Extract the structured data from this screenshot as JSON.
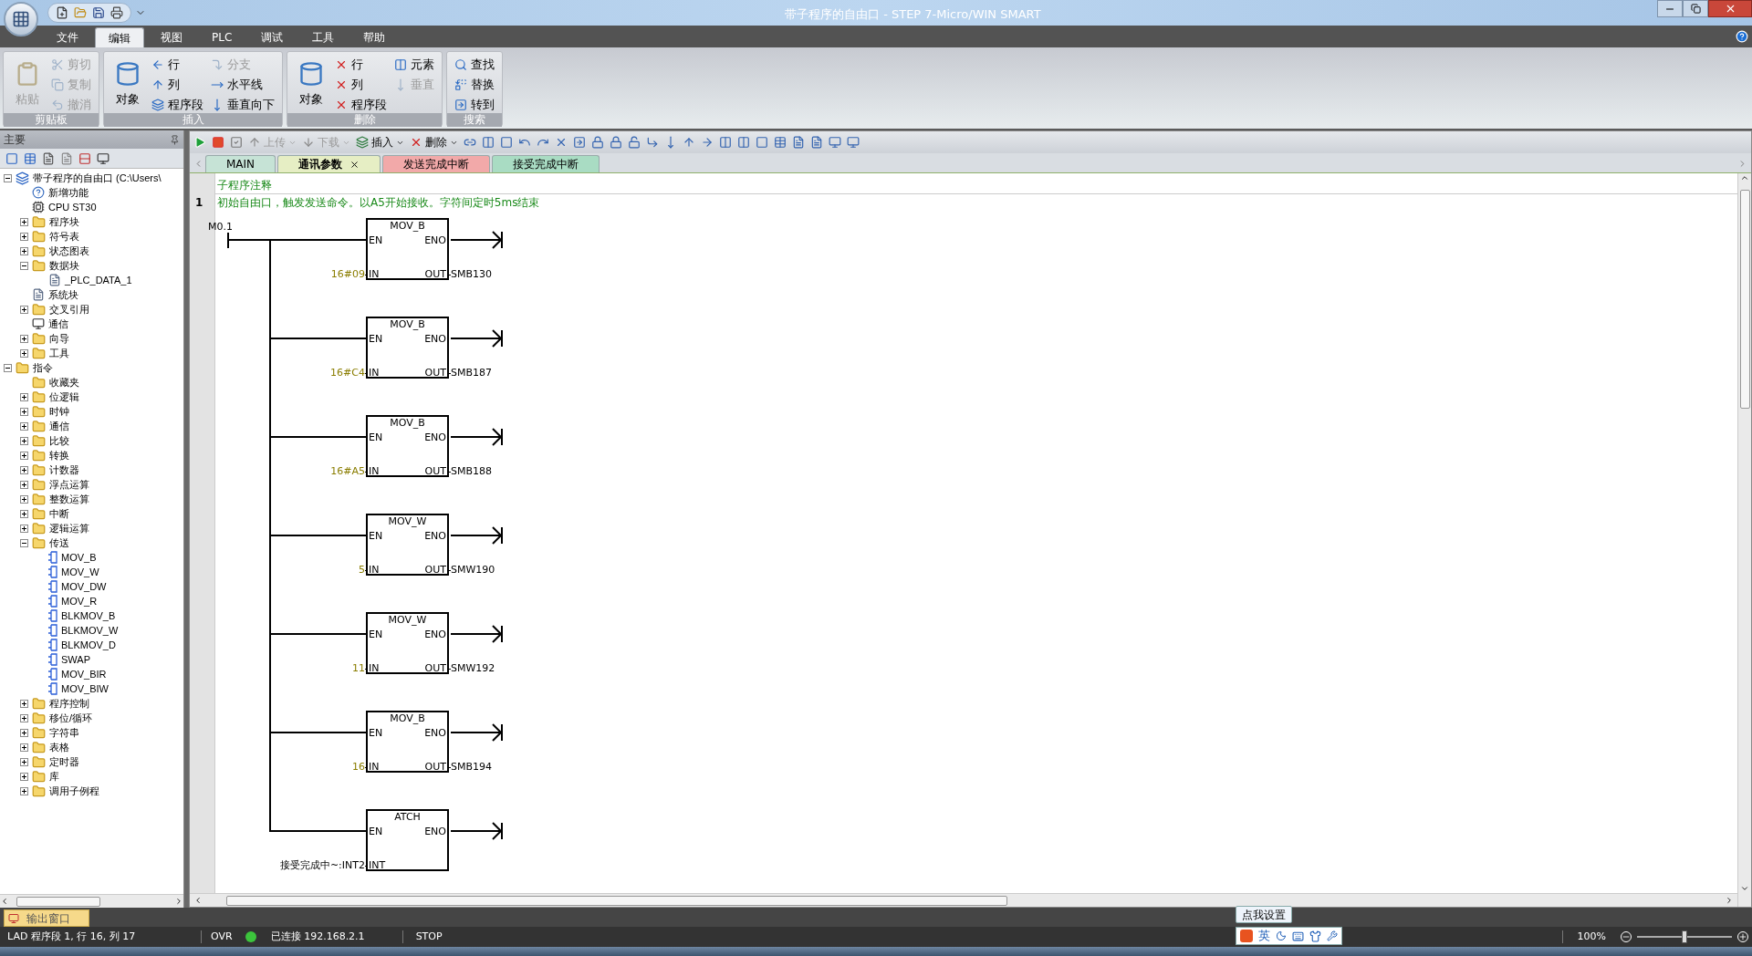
{
  "window": {
    "title": "带子程序的自由口 - STEP 7-Micro/WIN SMART"
  },
  "menu_tabs": [
    {
      "label": "文件",
      "selected": false
    },
    {
      "label": "编辑",
      "selected": true
    },
    {
      "label": "视图",
      "selected": false
    },
    {
      "label": "PLC",
      "selected": false
    },
    {
      "label": "调试",
      "selected": false
    },
    {
      "label": "工具",
      "selected": false
    },
    {
      "label": "帮助",
      "selected": false
    }
  ],
  "ribbon": {
    "groups": [
      {
        "title": "剪贴板",
        "large": {
          "label": "粘贴",
          "disabled": true
        },
        "items": [
          {
            "label": "剪切",
            "disabled": true
          },
          {
            "label": "复制",
            "disabled": true
          },
          {
            "label": "撤消",
            "disabled": true
          }
        ]
      },
      {
        "title": "插入",
        "large": {
          "label": "对象",
          "disabled": false
        },
        "items": [
          {
            "label": "行",
            "disabled": false
          },
          {
            "label": "列",
            "disabled": false
          },
          {
            "label": "程序段",
            "disabled": false
          },
          {
            "label": "分支",
            "disabled": true
          },
          {
            "label": "水平线",
            "disabled": false
          },
          {
            "label": "垂直向下",
            "disabled": false
          }
        ]
      },
      {
        "title": "删除",
        "large": {
          "label": "对象",
          "disabled": false
        },
        "items": [
          {
            "label": "行",
            "disabled": false
          },
          {
            "label": "列",
            "disabled": false
          },
          {
            "label": "程序段",
            "disabled": false
          },
          {
            "label": "元素",
            "disabled": false
          },
          {
            "label": "垂直",
            "disabled": true
          }
        ]
      },
      {
        "title": "搜索",
        "items": [
          {
            "label": "查找",
            "disabled": false
          },
          {
            "label": "替换",
            "disabled": false
          },
          {
            "label": "转到",
            "disabled": false
          }
        ]
      }
    ]
  },
  "panel": {
    "title": "主要"
  },
  "tree": [
    {
      "label": "带子程序的自由口 (C:\\Users\\",
      "kind": "project",
      "expanded": true,
      "children": [
        {
          "label": "新增功能",
          "kind": "help"
        },
        {
          "label": "CPU ST30",
          "kind": "cpu"
        },
        {
          "label": "程序块",
          "kind": "folder",
          "expanded": false
        },
        {
          "label": "符号表",
          "kind": "folder",
          "expanded": false
        },
        {
          "label": "状态图表",
          "kind": "folder",
          "expanded": false
        },
        {
          "label": "数据块",
          "kind": "folder",
          "expanded": true,
          "children": [
            {
              "label": "_PLC_DATA_1",
              "kind": "document"
            }
          ]
        },
        {
          "label": "系统块",
          "kind": "document"
        },
        {
          "label": "交叉引用",
          "kind": "folder",
          "expanded": false
        },
        {
          "label": "通信",
          "kind": "monitor"
        },
        {
          "label": "向导",
          "kind": "folder",
          "expanded": false
        },
        {
          "label": "工具",
          "kind": "folder",
          "expanded": false
        }
      ]
    },
    {
      "label": "指令",
      "kind": "folder",
      "expanded": true,
      "children": [
        {
          "label": "收藏夹",
          "kind": "folder"
        },
        {
          "label": "位逻辑",
          "kind": "folder",
          "expanded": false
        },
        {
          "label": "时钟",
          "kind": "folder",
          "expanded": false
        },
        {
          "label": "通信",
          "kind": "folder",
          "expanded": false
        },
        {
          "label": "比较",
          "kind": "folder",
          "expanded": false
        },
        {
          "label": "转换",
          "kind": "folder",
          "expanded": false
        },
        {
          "label": "计数器",
          "kind": "folder",
          "expanded": false
        },
        {
          "label": "浮点运算",
          "kind": "folder",
          "expanded": false
        },
        {
          "label": "整数运算",
          "kind": "folder",
          "expanded": false
        },
        {
          "label": "中断",
          "kind": "folder",
          "expanded": false
        },
        {
          "label": "逻辑运算",
          "kind": "folder",
          "expanded": false
        },
        {
          "label": "传送",
          "kind": "folder",
          "expanded": true,
          "children": [
            {
              "label": "MOV_B",
              "kind": "instruction"
            },
            {
              "label": "MOV_W",
              "kind": "instruction"
            },
            {
              "label": "MOV_DW",
              "kind": "instruction"
            },
            {
              "label": "MOV_R",
              "kind": "instruction"
            },
            {
              "label": "BLKMOV_B",
              "kind": "instruction"
            },
            {
              "label": "BLKMOV_W",
              "kind": "instruction"
            },
            {
              "label": "BLKMOV_D",
              "kind": "instruction"
            },
            {
              "label": "SWAP",
              "kind": "instruction"
            },
            {
              "label": "MOV_BIR",
              "kind": "instruction"
            },
            {
              "label": "MOV_BIW",
              "kind": "instruction"
            }
          ]
        },
        {
          "label": "程序控制",
          "kind": "folder",
          "expanded": false
        },
        {
          "label": "移位/循环",
          "kind": "folder",
          "expanded": false
        },
        {
          "label": "字符串",
          "kind": "folder",
          "expanded": false
        },
        {
          "label": "表格",
          "kind": "folder",
          "expanded": false
        },
        {
          "label": "定时器",
          "kind": "folder",
          "expanded": false
        },
        {
          "label": "库",
          "kind": "folder",
          "expanded": false
        },
        {
          "label": "调用子例程",
          "kind": "folder",
          "expanded": false
        }
      ]
    }
  ],
  "editor_toolbar": [
    {
      "label": "上传",
      "disabled": true
    },
    {
      "label": "下载",
      "disabled": true
    },
    {
      "label": "插入",
      "disabled": false
    },
    {
      "label": "删除",
      "disabled": false
    }
  ],
  "editor_tabs": [
    {
      "label": "MAIN",
      "selected": false,
      "color": "#c6e3d6"
    },
    {
      "label": "通讯参数",
      "selected": true,
      "color": "#e6eec4"
    },
    {
      "label": "发送完成中断",
      "selected": false,
      "color": "#f2a9a9"
    },
    {
      "label": "接受完成中断",
      "selected": false,
      "color": "#a9dcc3"
    }
  ],
  "subroutine_comment": "子程序注释",
  "network": {
    "number": "1",
    "comment": "初始自由口，触发发送命令。以A5开始接收。字符间定时5ms结束"
  },
  "ladder": {
    "contact": "M0.1",
    "rungs": [
      {
        "instruction": "MOV_B",
        "rows": [
          {
            "left": "EN",
            "right": "ENO"
          },
          {
            "left": "IN",
            "right": "OUT",
            "input": "16#09",
            "color": "#8a7d00",
            "output": "SMB130"
          }
        ]
      },
      {
        "instruction": "MOV_B",
        "rows": [
          {
            "left": "EN",
            "right": "ENO"
          },
          {
            "left": "IN",
            "right": "OUT",
            "input": "16#C4",
            "color": "#8a7d00",
            "output": "SMB187"
          }
        ]
      },
      {
        "instruction": "MOV_B",
        "rows": [
          {
            "left": "EN",
            "right": "ENO"
          },
          {
            "left": "IN",
            "right": "OUT",
            "input": "16#A5",
            "color": "#8a7d00",
            "output": "SMB188"
          }
        ]
      },
      {
        "instruction": "MOV_W",
        "rows": [
          {
            "left": "EN",
            "right": "ENO"
          },
          {
            "left": "IN",
            "right": "OUT",
            "input": "5",
            "color": "#8a7d00",
            "output": "SMW190"
          }
        ]
      },
      {
        "instruction": "MOV_W",
        "rows": [
          {
            "left": "EN",
            "right": "ENO"
          },
          {
            "left": "IN",
            "right": "OUT",
            "input": "11",
            "color": "#8a7d00",
            "output": "SMW192"
          }
        ]
      },
      {
        "instruction": "MOV_B",
        "rows": [
          {
            "left": "EN",
            "right": "ENO"
          },
          {
            "left": "IN",
            "right": "OUT",
            "input": "16",
            "color": "#8a7d00",
            "output": "SMB194"
          }
        ]
      },
      {
        "instruction": "ATCH",
        "rows": [
          {
            "left": "EN",
            "right": "ENO"
          },
          {
            "left": "INT",
            "input": "接受完成中~:INT2",
            "color": "#000000"
          }
        ]
      }
    ]
  },
  "output_tab": "输出窗口",
  "status_bar": {
    "position": "LAD 程序段 1, 行 16, 列 17",
    "mode": "OVR",
    "connection": {
      "connected": true,
      "text": "已连接 192.168.2.1"
    },
    "plc_state": "STOP",
    "zoom": {
      "text": "100%",
      "level": 0.5
    }
  },
  "ime": {
    "tooltip": "点我设置",
    "language": "英"
  }
}
